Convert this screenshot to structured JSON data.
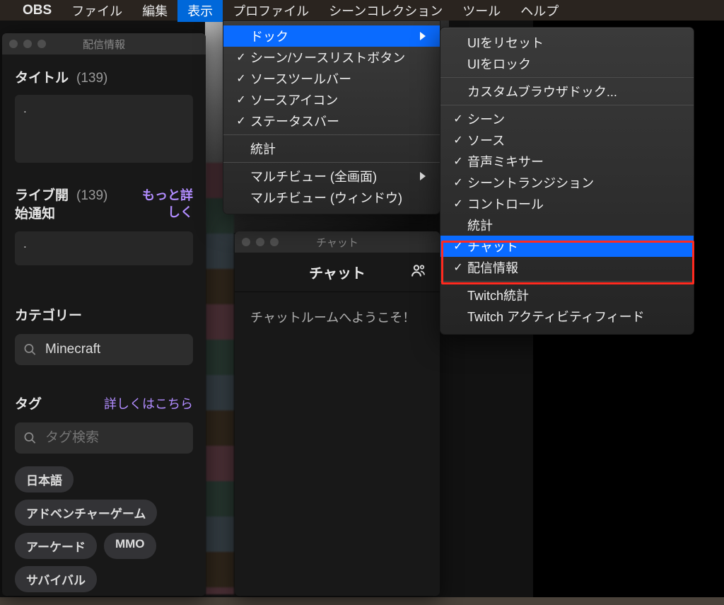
{
  "menubar": {
    "app": "OBS",
    "items": [
      "ファイル",
      "編集",
      "表示",
      "プロファイル",
      "シーンコレクション",
      "ツール",
      "ヘルプ"
    ],
    "active_index": 2
  },
  "view_menu": {
    "dock": "ドック",
    "scene_source_buttons": "シーン/ソースリストボタン",
    "source_toolbar": "ソースツールバー",
    "source_icons": "ソースアイコン",
    "status_bar": "ステータスバー",
    "stats": "統計",
    "multiview_full": "マルチビュー (全画面)",
    "multiview_win": "マルチビュー (ウィンドウ)"
  },
  "dock_menu": {
    "reset": "UIをリセット",
    "lock": "UIをロック",
    "custom_browser": "カスタムブラウザドック...",
    "scene": "シーン",
    "source": "ソース",
    "audio_mixer": "音声ミキサー",
    "scene_transition": "シーントランジション",
    "controls": "コントロール",
    "stats": "統計",
    "chat": "チャット",
    "stream_info": "配信情報",
    "twitch_stats": "Twitch統計",
    "twitch_activity": "Twitch アクティビティフィード"
  },
  "stream_panel": {
    "window_title": "配信情報",
    "title_label": "タイトル",
    "title_count": "(139)",
    "title_value": ".",
    "live_label_l1": "ライブ開",
    "live_label_l2": "始通知",
    "live_count": "(139)",
    "more_link_l1": "もっと詳",
    "more_link_l2": "しく",
    "live_value": ".",
    "category_label": "カテゴリー",
    "category_value": "Minecraft",
    "tag_label": "タグ",
    "tag_link": "詳しくはこちら",
    "tag_placeholder": "タグ検索",
    "chips": [
      "日本語",
      "アドベンチャーゲーム",
      "アーケード",
      "MMO",
      "サバイバル"
    ]
  },
  "chat_panel": {
    "window_title": "チャット",
    "header": "チャット",
    "welcome": "チャットルームへようこそ！"
  }
}
